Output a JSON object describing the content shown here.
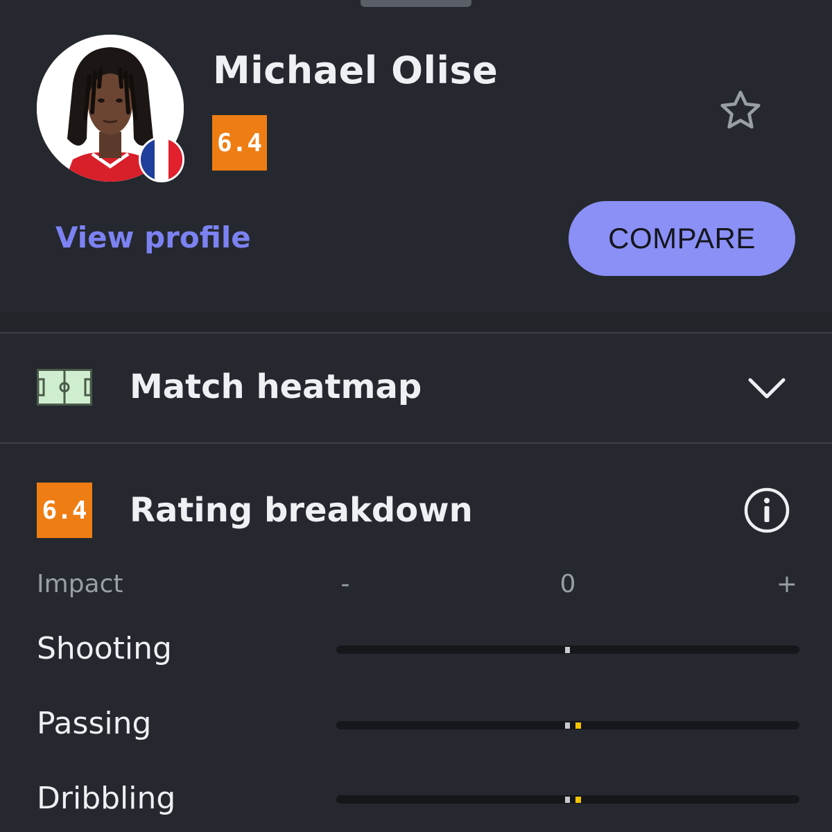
{
  "player": {
    "name": "Michael Olise",
    "rating": "6.4",
    "nationality_flag_colors": [
      "#1f3f9c",
      "#ffffff",
      "#e2202e"
    ]
  },
  "header": {
    "view_profile_label": "View profile",
    "compare_label": "COMPARE",
    "favorite_icon": "star-outline-icon"
  },
  "heatmap_section": {
    "title": "Match heatmap",
    "icon": "pitch-icon",
    "toggle_icon": "chevron-down-icon"
  },
  "rating_section": {
    "rating": "6.4",
    "title": "Rating breakdown",
    "info_icon": "info-icon",
    "scale": {
      "label": "Impact",
      "negative": "-",
      "zero": "0",
      "positive": "+"
    },
    "stats": [
      {
        "label": "Shooting",
        "impact": "neutral"
      },
      {
        "label": "Passing",
        "impact": "slightly-positive"
      },
      {
        "label": "Dribbling",
        "impact": "slightly-positive"
      }
    ]
  },
  "colors": {
    "background": "#25282e",
    "accent": "#8b90f6",
    "link": "#7c82f2",
    "rating_badge": "#ee7d14",
    "positive_marker": "#f5c400"
  }
}
